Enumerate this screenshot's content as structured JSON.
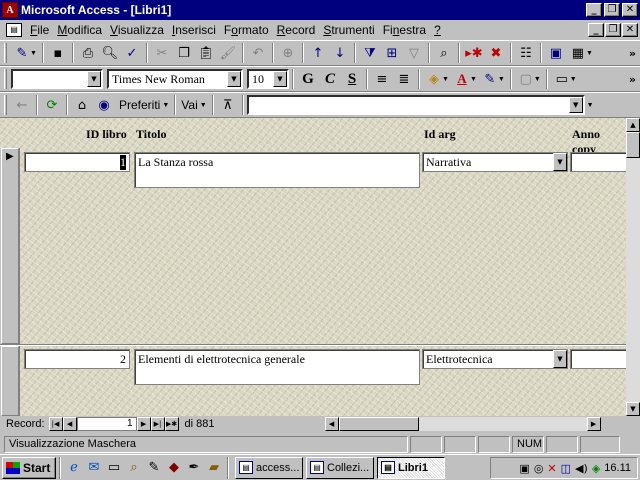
{
  "window": {
    "title": "Microsoft Access - [Libri1]",
    "app_icon_letter": "A"
  },
  "window_buttons": {
    "minimize": "_",
    "restore": "❐",
    "close": "✕"
  },
  "menu": [
    {
      "pre": "",
      "u": "F",
      "post": "ile"
    },
    {
      "pre": "",
      "u": "M",
      "post": "odifica"
    },
    {
      "pre": "",
      "u": "V",
      "post": "isualizza"
    },
    {
      "pre": "",
      "u": "I",
      "post": "nserisci"
    },
    {
      "pre": "F",
      "u": "o",
      "post": "rmato"
    },
    {
      "pre": "",
      "u": "R",
      "post": "ecord"
    },
    {
      "pre": "",
      "u": "S",
      "post": "trumenti"
    },
    {
      "pre": "Fi",
      "u": "n",
      "post": "estra"
    },
    {
      "pre": "",
      "u": "?",
      "post": ""
    }
  ],
  "format_toolbar": {
    "object_value": "",
    "font": "Times New Roman",
    "size": "10",
    "bold": "G",
    "italic": "C",
    "underline": "S"
  },
  "web_toolbar": {
    "favorites": "Preferiti",
    "go": "Vai",
    "address": ""
  },
  "form": {
    "headers": {
      "id": "ID libro",
      "title": "Titolo",
      "arg": "Id arg",
      "year": "Anno copy"
    },
    "records": [
      {
        "id": "1",
        "title": "La Stanza rossa",
        "arg": "Narrativa"
      },
      {
        "id": "2",
        "title": "Elementi di elettrotecnica generale",
        "arg": "Elettrotecnica"
      }
    ]
  },
  "navigation": {
    "label": "Record:",
    "current": "1",
    "total": "di 881"
  },
  "status": {
    "text": "Visualizzazione Maschera",
    "num": "NUM"
  },
  "taskbar": {
    "start": "Start",
    "tasks": [
      {
        "label": "access...",
        "active": false
      },
      {
        "label": "Collezi...",
        "active": false
      },
      {
        "label": "Libri1",
        "active": true
      }
    ],
    "clock": "16.11"
  }
}
